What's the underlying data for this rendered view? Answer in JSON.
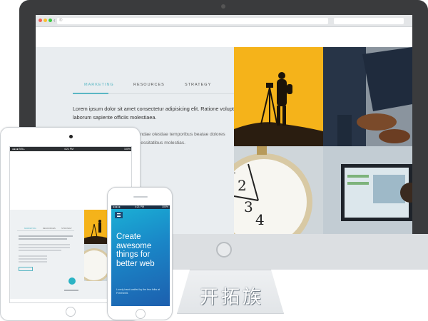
{
  "desktop": {
    "url": "®",
    "tabs": [
      "MARKETING",
      "RESOURCES",
      "STRATEGY"
    ],
    "paragraph_main": "Lorem ipsum dolor sit amet consectetur adipisicing elit. Ratione voluptate laborum sapiente officiis molestiaea.",
    "paragraph_secondary": "sectetur adipisicing elit. Repudiandae olestiae temporibus beatae dolores oremque ad, eaque pariatur, necessitatibus molestias."
  },
  "watermark": "开拓族",
  "tablet": {
    "status_left": "●●●● BELL",
    "status_time": "4:21 PM",
    "status_right": "100%",
    "tabs": [
      "MARKETING",
      "RESOURCES",
      "STRATEGY"
    ]
  },
  "phone": {
    "status_left": "●●●●●",
    "status_time": "4:21 PM",
    "status_right": "100%",
    "headline": "Create awesome things for better web",
    "subtext": "Lovely hand crafted by the few folks at Freehtml5."
  },
  "colors": {
    "accent": "#5ab7c4",
    "yellow": "#f5b31a",
    "phone_blue": "#1a86c7"
  }
}
